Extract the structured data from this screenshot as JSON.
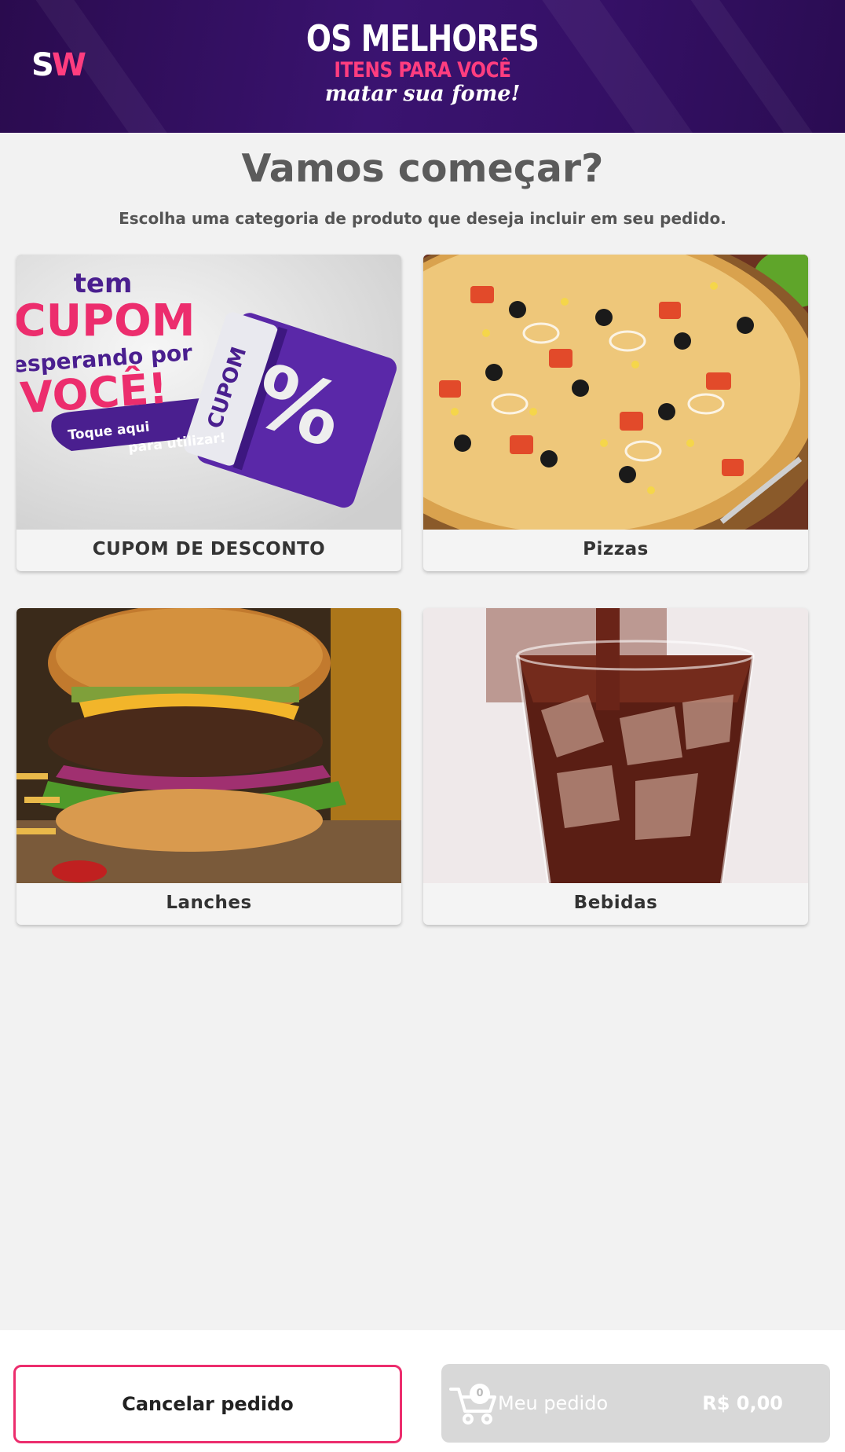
{
  "banner": {
    "logo_s": "S",
    "logo_w": "W",
    "line1": "OS MELHORES",
    "line2": "ITENS PARA VOCÊ",
    "line3": "matar sua fome!"
  },
  "main": {
    "title": "Vamos começar?",
    "subtitle": "Escolha uma categoria de produto que deseja incluir em seu pedido."
  },
  "categories": [
    {
      "label": "CUPOM DE DESCONTO",
      "promo": {
        "line1": "tem",
        "line2": "CUPOM",
        "line3": "esperando por",
        "line4": "VOCÊ!",
        "cta1": "Toque aqui",
        "cta2": "para utilizar!",
        "ticket": "CUPOM",
        "percent": "%"
      }
    },
    {
      "label": "Pizzas"
    },
    {
      "label": "Lanches"
    },
    {
      "label": "Bebidas"
    }
  ],
  "footer": {
    "cancel_label": "Cancelar pedido",
    "order_label": "Meu pedido",
    "cart_count": "0",
    "order_total": "R$ 0,00"
  },
  "colors": {
    "accent": "#ec2d6d",
    "banner": "#3a1370",
    "background": "#f2f2f2"
  }
}
